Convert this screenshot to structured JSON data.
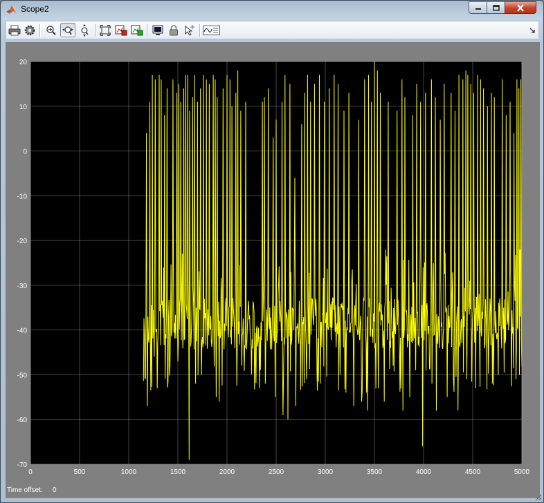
{
  "window": {
    "title": "Scope2"
  },
  "toolbar": {
    "buttons": [
      {
        "name": "print",
        "icon": "printer-icon"
      },
      {
        "name": "parameters",
        "icon": "gear-icon"
      },
      {
        "name": "zoom-in",
        "icon": "zoom-in-icon"
      },
      {
        "name": "zoom-x",
        "icon": "zoom-x-icon",
        "active": true
      },
      {
        "name": "zoom-y",
        "icon": "zoom-y-icon"
      },
      {
        "name": "autoscale",
        "icon": "autoscale-icon"
      },
      {
        "name": "save-axes",
        "icon": "save-axes-icon"
      },
      {
        "name": "restore-axes",
        "icon": "restore-axes-icon"
      },
      {
        "name": "floating-scope",
        "icon": "floating-scope-icon"
      },
      {
        "name": "lock-axes",
        "icon": "lock-icon"
      },
      {
        "name": "signal-selection",
        "icon": "signal-selection-icon"
      },
      {
        "name": "legends",
        "icon": "legend-icon"
      }
    ]
  },
  "status": {
    "time_offset_label": "Time offset:",
    "time_offset_value": "0"
  },
  "colors": {
    "figure_bg": "#808080",
    "axes_bg": "#000000",
    "grid": "#8c8c8c",
    "trace": "#ffff00",
    "tick_text": "#ffffff"
  },
  "chart_data": {
    "type": "line",
    "title": "",
    "xlabel": "",
    "ylabel": "",
    "xlim": [
      0,
      5000
    ],
    "ylim": [
      -70,
      20
    ],
    "xticks": [
      "0",
      "500",
      "1000",
      "1500",
      "2000",
      "2500",
      "3000",
      "3500",
      "4000",
      "4500",
      "5000"
    ],
    "yticks": [
      "20",
      "10",
      "0",
      "-10",
      "-20",
      "-30",
      "-40",
      "-50",
      "-60",
      "-70"
    ],
    "grid": true,
    "legend": "none",
    "series": [
      {
        "color": "#ffff00",
        "signal_start": 1150,
        "signal_end": 5000,
        "baseline_range": [
          -45,
          -32
        ],
        "min": -69,
        "max": 20,
        "spikes_up": [
          [
            1180,
            4
          ],
          [
            1215,
            11
          ],
          [
            1240,
            17
          ],
          [
            1270,
            16
          ],
          [
            1290,
            10
          ],
          [
            1310,
            17
          ],
          [
            1330,
            16
          ],
          [
            1365,
            8
          ],
          [
            1390,
            14
          ],
          [
            1420,
            17
          ],
          [
            1450,
            16
          ],
          [
            1490,
            13
          ],
          [
            1510,
            15
          ],
          [
            1530,
            11
          ],
          [
            1560,
            14
          ],
          [
            1580,
            17
          ],
          [
            1600,
            17
          ],
          [
            1620,
            9
          ],
          [
            1650,
            12
          ],
          [
            1670,
            17
          ],
          [
            1700,
            11
          ],
          [
            1730,
            14
          ],
          [
            1760,
            17
          ],
          [
            1790,
            16
          ],
          [
            1820,
            15
          ],
          [
            1860,
            17
          ],
          [
            1880,
            16
          ],
          [
            1900,
            12
          ],
          [
            1920,
            17
          ],
          [
            1960,
            14
          ],
          [
            2000,
            17
          ],
          [
            2030,
            16
          ],
          [
            2050,
            10
          ],
          [
            2090,
            13
          ],
          [
            2110,
            18
          ],
          [
            2140,
            9
          ],
          [
            2190,
            11
          ],
          [
            2330,
            12
          ],
          [
            2360,
            11
          ],
          [
            2380,
            12
          ],
          [
            2420,
            14
          ],
          [
            2470,
            3
          ],
          [
            2500,
            7
          ],
          [
            2560,
            11
          ],
          [
            2590,
            17
          ],
          [
            2640,
            15
          ],
          [
            2690,
            -6
          ],
          [
            2700,
            12
          ],
          [
            2760,
            6
          ],
          [
            2790,
            13
          ],
          [
            2820,
            17
          ],
          [
            2850,
            11
          ],
          [
            2890,
            15
          ],
          [
            2940,
            17
          ],
          [
            2990,
            11
          ],
          [
            3040,
            14
          ],
          [
            3090,
            17
          ],
          [
            3130,
            15
          ],
          [
            3190,
            9
          ],
          [
            3240,
            13
          ],
          [
            3290,
            17
          ],
          [
            3340,
            7
          ],
          [
            3370,
            2
          ],
          [
            3400,
            16
          ],
          [
            3440,
            17
          ],
          [
            3470,
            11
          ],
          [
            3500,
            20
          ],
          [
            3530,
            18
          ],
          [
            3560,
            13
          ],
          [
            3600,
            16
          ],
          [
            3640,
            11
          ],
          [
            3690,
            6
          ],
          [
            3730,
            9
          ],
          [
            3780,
            16
          ],
          [
            3810,
            12
          ],
          [
            3860,
            5
          ],
          [
            3890,
            8
          ],
          [
            3930,
            15
          ],
          [
            3970,
            11
          ],
          [
            4020,
            13
          ],
          [
            4080,
            16
          ],
          [
            4120,
            12
          ],
          [
            4170,
            7
          ],
          [
            4210,
            15
          ],
          [
            4240,
            10
          ],
          [
            4280,
            13
          ],
          [
            4320,
            9
          ],
          [
            4360,
            17
          ],
          [
            4400,
            16
          ],
          [
            4430,
            18
          ],
          [
            4450,
            17
          ],
          [
            4480,
            15
          ],
          [
            4510,
            13
          ],
          [
            4550,
            17
          ],
          [
            4580,
            16
          ],
          [
            4610,
            14
          ],
          [
            4650,
            10
          ],
          [
            4690,
            13
          ],
          [
            4720,
            12
          ],
          [
            4760,
            14
          ],
          [
            4800,
            16
          ],
          [
            4840,
            8
          ],
          [
            4880,
            11
          ],
          [
            4920,
            4
          ],
          [
            4950,
            16
          ],
          [
            4970,
            14
          ],
          [
            4990,
            16
          ]
        ],
        "spikes_down": [
          [
            1170,
            -51
          ],
          [
            1190,
            -57
          ],
          [
            1260,
            -46
          ],
          [
            1290,
            -53
          ],
          [
            1420,
            -48
          ],
          [
            1500,
            -47
          ],
          [
            1615,
            -69
          ],
          [
            1680,
            -52
          ],
          [
            1740,
            -50
          ],
          [
            1890,
            -55
          ],
          [
            1920,
            -56
          ],
          [
            2150,
            -48
          ],
          [
            2330,
            -53
          ],
          [
            2390,
            -52
          ],
          [
            2490,
            -55
          ],
          [
            2570,
            -59
          ],
          [
            2620,
            -60
          ],
          [
            2700,
            -57
          ],
          [
            2810,
            -51
          ],
          [
            2950,
            -52
          ],
          [
            3150,
            -50
          ],
          [
            3290,
            -57
          ],
          [
            3370,
            -56
          ],
          [
            3430,
            -58
          ],
          [
            3540,
            -53
          ],
          [
            3600,
            -56
          ],
          [
            3690,
            -48
          ],
          [
            3790,
            -58
          ],
          [
            3860,
            -55
          ],
          [
            3920,
            -49
          ],
          [
            3990,
            -66
          ],
          [
            4130,
            -58
          ],
          [
            4240,
            -55
          ],
          [
            4350,
            -58
          ],
          [
            4440,
            -51
          ],
          [
            4530,
            -53
          ],
          [
            4700,
            -52
          ],
          [
            4760,
            -50
          ],
          [
            4940,
            -51
          ]
        ]
      }
    ]
  }
}
